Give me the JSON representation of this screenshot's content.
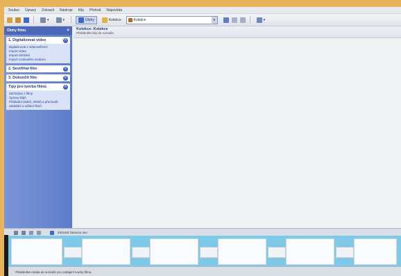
{
  "menubar": {
    "items": [
      "Soubor",
      "Úpravy",
      "Zobrazit",
      "Nástroje",
      "Klip",
      "Přehrát",
      "Nápověda"
    ]
  },
  "toolbar": {
    "tasks_label": "Úlohy",
    "collections_label": "Kolekce",
    "collection_select": "Kolekce"
  },
  "taskpane": {
    "title": "Úlohy filmu",
    "sections": [
      {
        "label": "1. Digitalizovat video",
        "links": [
          "Digitalizovat z videozařízení",
          "Import videa",
          "Import obrázků",
          "Import zvukového souboru"
        ]
      },
      {
        "label": "2. Sestřihat film",
        "links": []
      },
      {
        "label": "3. Dokončit film",
        "links": []
      },
      {
        "label": "Tipy pro tvorbu filmů",
        "links": [
          "Začínáme s filmy",
          "Úpravy klipů",
          "Přidávání titulků, efektů a přechodů",
          "Ukládání a sdílení filmů"
        ]
      }
    ]
  },
  "collection": {
    "title": "Kolekce: Kolekce",
    "subtitle": "Přetáhněte klip do scénáře."
  },
  "storyboard": {
    "label": "Zobrazit časovou osu"
  },
  "status": {
    "text": "Přetáhněte média do scénáře pro zahájení tvorby filmu."
  }
}
